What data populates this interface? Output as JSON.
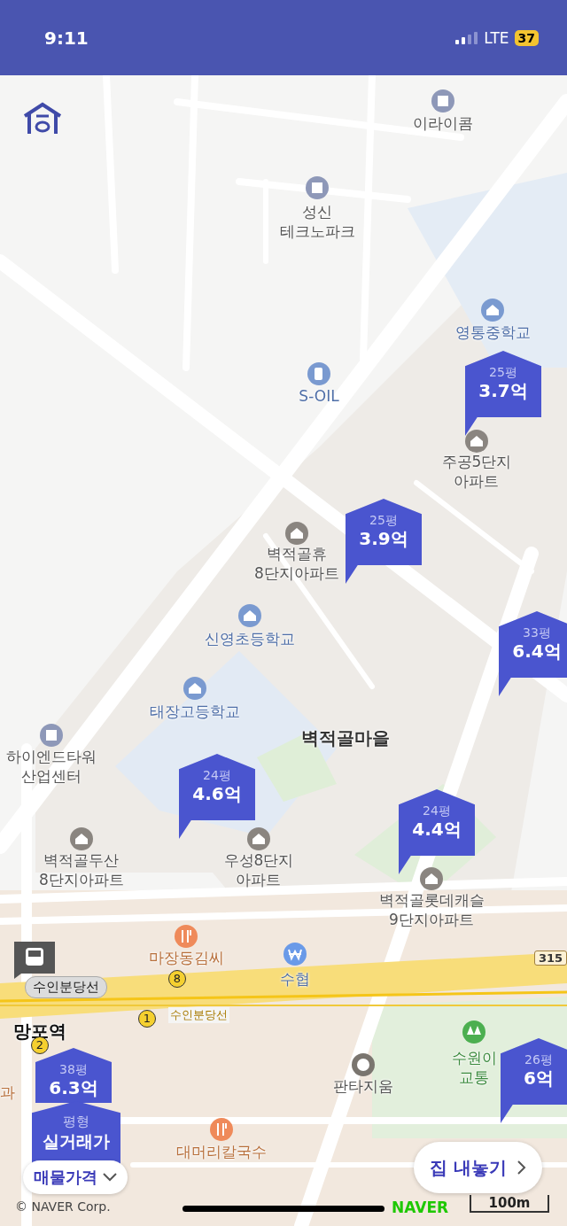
{
  "status_bar": {
    "time": "9:11",
    "network": "LTE",
    "battery": "37"
  },
  "places": [
    {
      "name": "이라이콤",
      "kind": "building"
    },
    {
      "name": "성신\n테크노파크",
      "kind": "building"
    },
    {
      "name": "영통중학교",
      "kind": "school"
    },
    {
      "name": "S-OIL",
      "kind": "fuel"
    },
    {
      "name": "주공5단지\n아파트",
      "kind": "apartment"
    },
    {
      "name": "벽적골휴\n8단지아파트",
      "kind": "apartment"
    },
    {
      "name": "신영초등학교",
      "kind": "school"
    },
    {
      "name": "태장고등학교",
      "kind": "school"
    },
    {
      "name": "하이엔드타워\n산업센터",
      "kind": "building"
    },
    {
      "name": "벽적골마을",
      "kind": "area"
    },
    {
      "name": "벽적골두산\n8단지아파트",
      "kind": "apartment"
    },
    {
      "name": "우성8단지\n아파트",
      "kind": "apartment"
    },
    {
      "name": "벽적골롯데캐슬\n9단지아파트",
      "kind": "apartment"
    },
    {
      "name": "마장동김씨",
      "kind": "restaurant"
    },
    {
      "name": "수협",
      "kind": "bank"
    },
    {
      "name": "망포역",
      "kind": "station"
    },
    {
      "name": "판타지움",
      "kind": "theater"
    },
    {
      "name": "수원이\n교통",
      "kind": "park"
    },
    {
      "name": "대머리칼국수",
      "kind": "restaurant"
    },
    {
      "name": "과",
      "kind": "area_cut"
    }
  ],
  "transit": {
    "line_chip": "수인분당선",
    "line_label": "수인분당선",
    "route": "315",
    "exits": [
      "8",
      "1",
      "2"
    ]
  },
  "pins": [
    {
      "area": "25평",
      "price": "3.7억"
    },
    {
      "area": "25평",
      "price": "3.9억"
    },
    {
      "area": "33평",
      "price": "6.4억"
    },
    {
      "area": "24평",
      "price": "4.6억"
    },
    {
      "area": "24평",
      "price": "4.4억"
    },
    {
      "area": "26평",
      "price": "6억"
    },
    {
      "area": "38평",
      "price": "6.3억"
    }
  ],
  "legend": {
    "area_label": "평형",
    "price_label": "실거래가"
  },
  "price_filter": {
    "label": "매물가격"
  },
  "list_button": {
    "label": "집 내놓기"
  },
  "footer": {
    "copyright": "© NAVER Corp.",
    "logo": "NAVER",
    "scale": "100m"
  }
}
